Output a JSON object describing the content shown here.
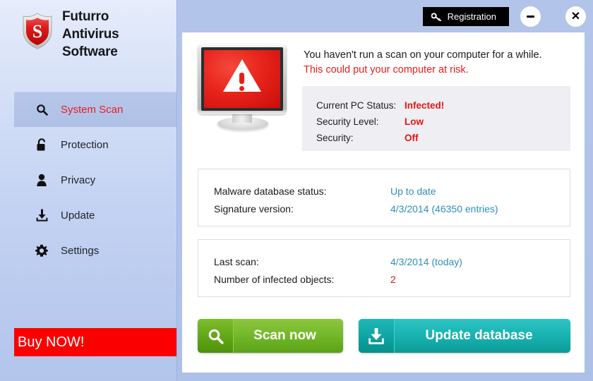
{
  "brand": {
    "line1": "Futurro",
    "line2": "Antivirus",
    "line3": "Software",
    "logo_icon": "shield-s-icon",
    "logo_letter": "S"
  },
  "sidebar": {
    "items": [
      {
        "label": "System Scan",
        "icon": "magnifier-icon",
        "active": true
      },
      {
        "label": "Protection",
        "icon": "lock-icon",
        "active": false
      },
      {
        "label": "Privacy",
        "icon": "person-icon",
        "active": false
      },
      {
        "label": "Update",
        "icon": "download-icon",
        "active": false
      },
      {
        "label": "Settings",
        "icon": "gear-icon",
        "active": false
      }
    ],
    "buy_now": "Buy NOW!"
  },
  "titlebar": {
    "registration": "Registration",
    "registration_icon": "key-icon",
    "minimize_icon": "minimize-icon",
    "close_icon": "close-icon",
    "close_glyph": "✕"
  },
  "hero": {
    "icon": "monitor-warning-icon",
    "line1": "You haven't run a scan on your computer for a while.",
    "line2": "This could put your computer at risk."
  },
  "status": {
    "rows": [
      {
        "label": "Current PC Status:",
        "value": "Infected!"
      },
      {
        "label": "Security Level:",
        "value": "Low"
      },
      {
        "label": "Security:",
        "value": "Off"
      }
    ]
  },
  "database_box": {
    "rows": [
      {
        "label": "Malware database status:",
        "value": "Up to date",
        "alert": false
      },
      {
        "label": "Signature version:",
        "value": "4/3/2014 (46350 entries)",
        "alert": false
      }
    ]
  },
  "scan_box": {
    "rows": [
      {
        "label": "Last scan:",
        "value": "4/3/2014 (today)",
        "alert": false
      },
      {
        "label": "Number of infected objects:",
        "value": "2",
        "alert": true
      }
    ]
  },
  "actions": {
    "scan": {
      "label": "Scan now",
      "icon": "magnifier-icon"
    },
    "update": {
      "label": "Update database",
      "icon": "download-icon"
    }
  },
  "colors": {
    "accent_red": "#ee1c1c",
    "buy_red": "#fb0000",
    "value_blue": "#2e8fb8",
    "alert_red": "#b42222",
    "scan_green": "#74b82b",
    "update_teal": "#18b3b1",
    "sidebar_blue": "#c3d2f2",
    "window_blue": "#b0c2e9"
  }
}
